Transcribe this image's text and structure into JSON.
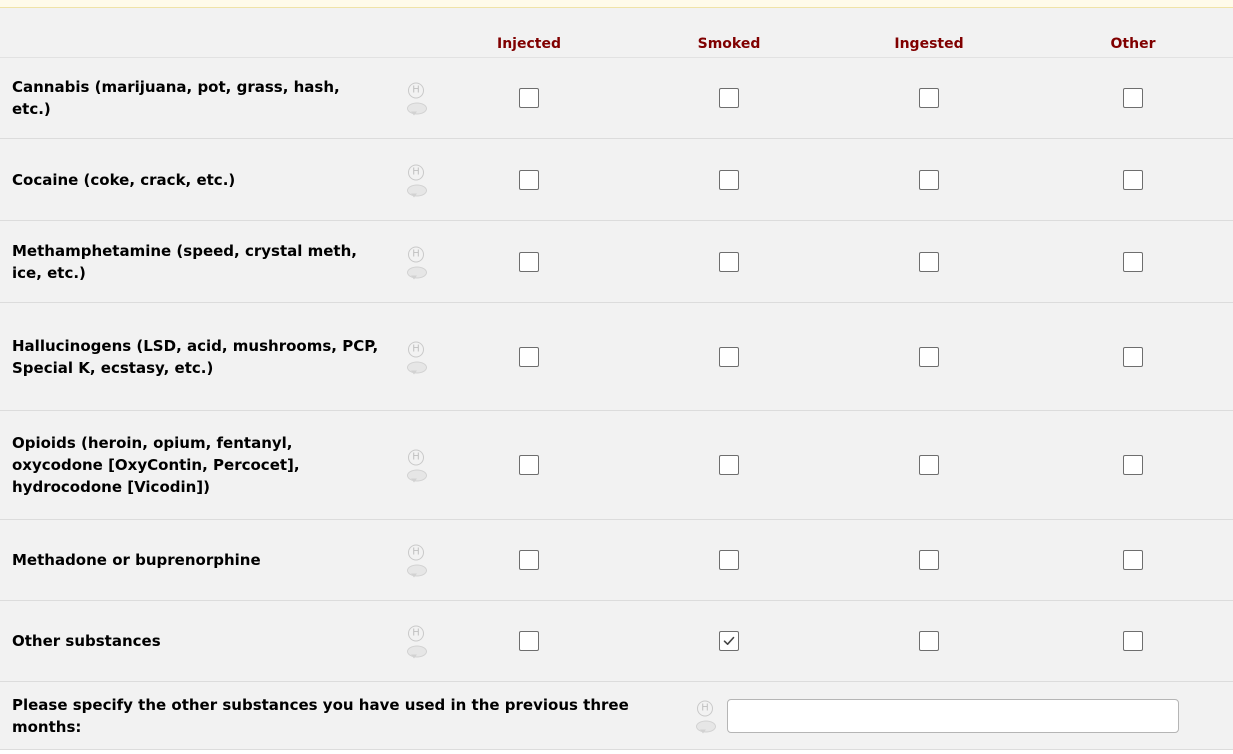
{
  "columns": [
    "Injected",
    "Smoked",
    "Ingested",
    "Other"
  ],
  "rows": [
    {
      "label": "Cannabis (marijuana, pot, grass, hash, etc.)",
      "checked": [
        false,
        false,
        false,
        false
      ]
    },
    {
      "label": "Cocaine (coke, crack, etc.)",
      "checked": [
        false,
        false,
        false,
        false
      ]
    },
    {
      "label": "Methamphetamine (speed, crystal meth, ice, etc.)",
      "checked": [
        false,
        false,
        false,
        false
      ]
    },
    {
      "label": "Hallucinogens (LSD, acid, mushrooms, PCP, Special K, ecstasy, etc.)",
      "checked": [
        false,
        false,
        false,
        false
      ]
    },
    {
      "label": "Opioids (heroin, opium, fentanyl, oxycodone [OxyContin, Percocet], hydrocodone [Vicodin])",
      "checked": [
        false,
        false,
        false,
        false
      ]
    },
    {
      "label": "Methadone or buprenorphine",
      "checked": [
        false,
        false,
        false,
        false
      ]
    },
    {
      "label": "Other substances",
      "checked": [
        false,
        true,
        false,
        false
      ]
    }
  ],
  "specify": {
    "label": "Please specify the other substances you have used in the previous three months:",
    "value": ""
  },
  "icons": {
    "history": "H",
    "history_name": "history-icon",
    "comment_name": "comment-icon"
  }
}
